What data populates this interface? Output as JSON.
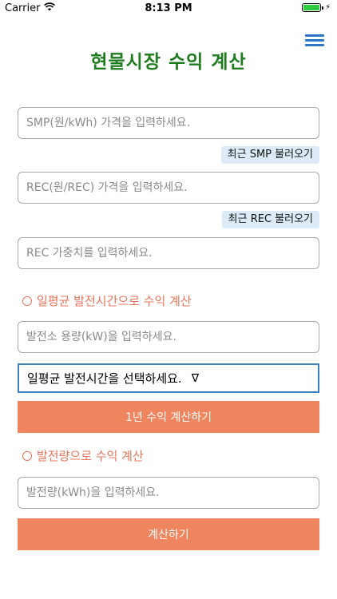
{
  "status_bar": {
    "carrier": "Carrier",
    "time": "8:13 PM"
  },
  "header": {
    "title": "현물시장 수익 계산"
  },
  "inputs": {
    "smp_placeholder": "SMP(원/kWh) 가격을 입력하세요.",
    "rec_placeholder": "REC(원/REC) 가격을 입력하세요.",
    "rec_weight_placeholder": "REC 가중치를 입력하세요.",
    "capacity_placeholder": "발전소 용량(kW)을 입력하세요.",
    "generation_placeholder": "발전량(kWh)을 입력하세요."
  },
  "buttons": {
    "fetch_smp": "최근 SMP 불러오기",
    "fetch_rec": "최근 REC 불러오기",
    "calc_yearly": "1년 수익 계산하기",
    "calc": "계산하기"
  },
  "sections": {
    "by_hours": "일평균 발전시간으로 수익 계산",
    "by_generation": "발전량으로 수익 계산"
  },
  "select": {
    "hours_value": "일평균 발전시간을 선택하세요.",
    "indicator": "∇"
  },
  "colors": {
    "title": "#1e7b1e",
    "accent": "#ee855e",
    "section": "#e8745a",
    "menu": "#2b75c9",
    "fetch_bg": "#dcebf7"
  }
}
